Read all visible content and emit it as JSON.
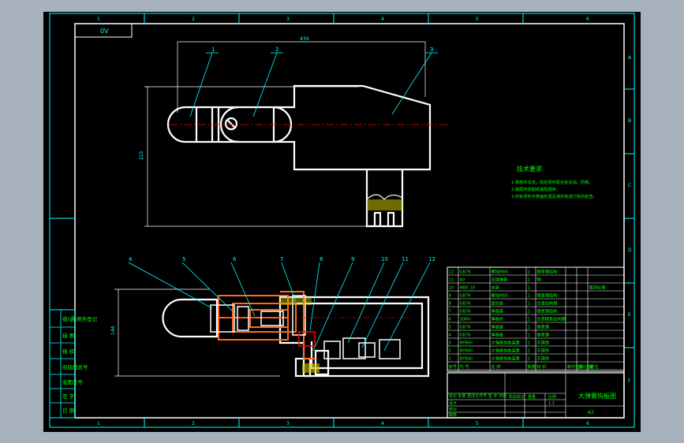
{
  "drawing": {
    "corner_label": "0V",
    "title": "大弹簧钩板图",
    "scale_text": "A2",
    "tech_requirements": {
      "heading": "技术要求",
      "lines": [
        "1.零部件清洗，前后零件配合处涂油，防锈。",
        "2.装配时按图纸装配顺序。",
        "3.所有零件外表面处理及保护前进行探伤检查。"
      ]
    },
    "top_view_dims": {
      "width": "434",
      "height": "215"
    },
    "side_view_dim": "144",
    "part_balloons_top": [
      "1",
      "2",
      "3"
    ],
    "part_balloons_bottom": [
      "4",
      "5",
      "6",
      "7",
      "8",
      "9",
      "10",
      "11",
      "12"
    ],
    "frame_cols": [
      "1",
      "2",
      "3",
      "4",
      "5",
      "6"
    ],
    "frame_rows": [
      "A",
      "B",
      "C",
      "D",
      "E",
      "F"
    ],
    "left_column": [
      "借(通)用件登记",
      "描  图",
      "描  校",
      "旧底图总号",
      "底图总号",
      "签  字",
      "日  期"
    ],
    "bom": {
      "headers": [
        "序号",
        "代  号",
        "名  称",
        "数量",
        "材  料",
        "单件重量",
        "总计重量",
        "备  注"
      ],
      "rows": [
        [
          "12",
          "GB76",
          "螺栓M8X",
          "2",
          "碳素钢结构",
          "",
          "",
          ""
        ],
        [
          "11",
          "40",
          "压缩弹簧",
          "2",
          "钢",
          "",
          "",
          ""
        ],
        [
          "10",
          "M8X 20",
          "支座",
          "1",
          "",
          "",
          "",
          "镀锌处理"
        ],
        [
          "9",
          "GB76",
          "螺栓M8X",
          "1",
          "碳素钢结构",
          "",
          "",
          ""
        ],
        [
          "8",
          "GB76",
          "盘形板",
          "1",
          "合金结构钢",
          "",
          "",
          ""
        ],
        [
          "7",
          "GB76",
          "弹簧座",
          "2",
          "碳素钢结构",
          "",
          "",
          ""
        ],
        [
          "6",
          "30Mn",
          "弹簧杆",
          "1",
          "优质碳素结构钢",
          "",
          "",
          ""
        ],
        [
          "5",
          "GB76",
          "弹簧座",
          "1",
          "碳素钢",
          "",
          "",
          ""
        ],
        [
          "4",
          "GB76",
          "弹簧座",
          "1",
          "碳素钢",
          "",
          "",
          ""
        ],
        [
          "3",
          "BYB60",
          "大弹簧钩板装置",
          "1",
          "灰铸铁",
          "",
          "",
          ""
        ],
        [
          "2",
          "BYB60",
          "大弹簧钩板装置",
          "1",
          "灰铸铁",
          "",
          "",
          ""
        ],
        [
          "1",
          "BYB60",
          "大弹簧钩板装置",
          "1",
          "灰铸铁",
          "",
          "",
          ""
        ]
      ]
    },
    "titleblock": {
      "rows": [
        "标记 处数 更改文件号 签 字 日期",
        "设计",
        "校对",
        "审核",
        "工艺"
      ],
      "stage_label": "阶段标记",
      "weight_label": "重量",
      "ratio_label": "比例",
      "ratio_value": "1:1"
    },
    "colors": {
      "background": "#000000",
      "frame": "#ffffff",
      "annotation": "#00ffff",
      "text": "#00ff00",
      "centerline": "#ff0000",
      "window": "#a7b1bb"
    }
  }
}
